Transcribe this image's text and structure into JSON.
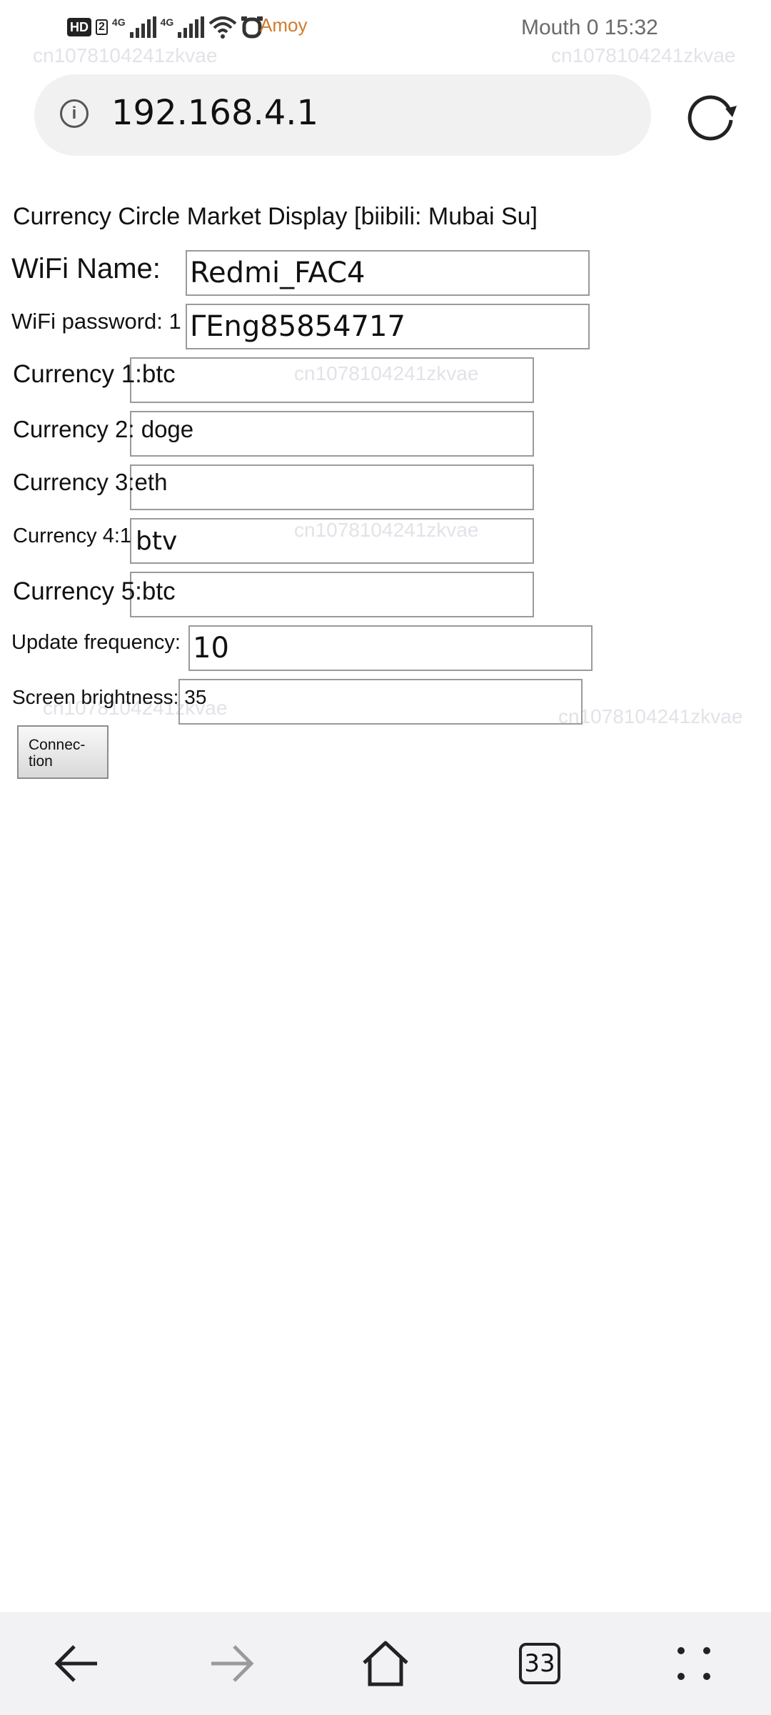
{
  "status_bar": {
    "hd_badge": "HD",
    "sim_badge": "2",
    "net1": "4G",
    "net2": "4G",
    "carrier": "Amoy",
    "clock": "Mouth 0 15:32",
    "icons": [
      "hd-icon",
      "signal-icon",
      "signal-icon",
      "wifi-icon",
      "alarm-icon"
    ]
  },
  "url_bar": {
    "url": "192.168.4.1",
    "info_icon": "i"
  },
  "form": {
    "title": "Currency Circle Market Display [biibili: Mubai Su]",
    "wifi_name_label": "WiFi Name:",
    "wifi_name_value": "Redmi_FAC4",
    "wifi_password_label": "WiFi password: 1",
    "wifi_password_value": "ΓEng85854717",
    "currency1_label": "Currency 1:btc",
    "currency1_value": "",
    "currency2_label": "Currency 2: doge",
    "currency2_value": "",
    "currency3_label": "Currency 3:eth",
    "currency3_value": "",
    "currency4_label": "Currency 4:1",
    "currency4_value": "btv",
    "currency5_label": "Currency 5:btc",
    "currency5_value": "",
    "update_label": "Update frequency:",
    "update_value": "10",
    "brightness_label": "Screen brightness: 35",
    "brightness_value": "",
    "connect_button": "Connec- tion"
  },
  "watermark": "cn1078104241zkvae",
  "nav_bar": {
    "tab_count": "33",
    "icons": [
      "back-arrow-icon",
      "forward-arrow-icon",
      "home-icon",
      "tabs-icon",
      "more-icon"
    ]
  }
}
